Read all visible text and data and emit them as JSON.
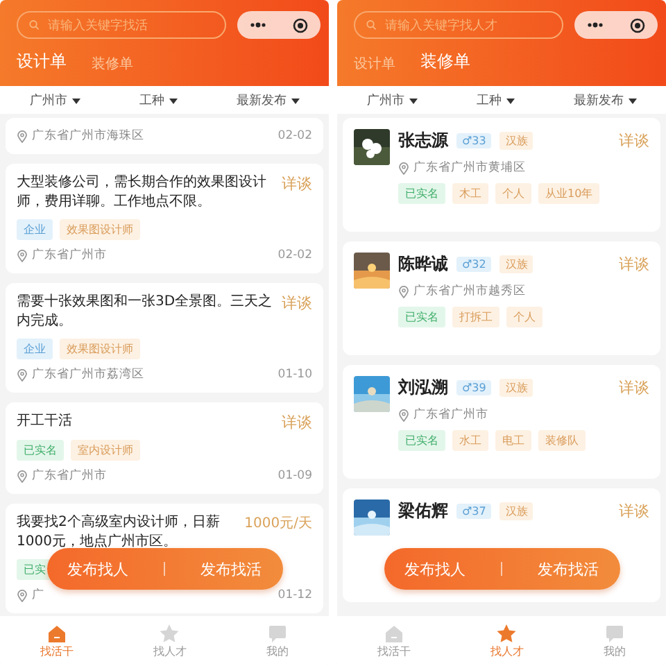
{
  "screens": [
    {
      "search": {
        "placeholder": "请输入关键字找活"
      },
      "tabs": [
        {
          "label": "设计单",
          "selected": true
        },
        {
          "label": "装修单",
          "selected": false
        }
      ],
      "filters": [
        "广州市",
        "工种",
        "最新发布"
      ],
      "jobs": [
        {
          "location": "广东省广州市海珠区",
          "date": "02-02"
        },
        {
          "title": "大型装修公司，需长期合作的效果图设计师，费用详聊。工作地点不限。",
          "pay": "详谈",
          "tags": [
            {
              "kind": "company",
              "label": "企业"
            },
            {
              "kind": "trade",
              "label": "效果图设计师"
            }
          ],
          "location": "广东省广州市",
          "date": "02-02"
        },
        {
          "title": "需要十张效果图和一张3D全景图。三天之内完成。",
          "pay": "详谈",
          "tags": [
            {
              "kind": "company",
              "label": "企业"
            },
            {
              "kind": "trade",
              "label": "效果图设计师"
            }
          ],
          "location": "广东省广州市荔湾区",
          "date": "01-10"
        },
        {
          "title": "开工干活",
          "pay": "详谈",
          "tags": [
            {
              "kind": "verified",
              "label": "已实名"
            },
            {
              "kind": "trade",
              "label": "室内设计师"
            }
          ],
          "location": "广东省广州市",
          "date": "01-09"
        },
        {
          "title": "我要找2个高级室内设计师，日薪1000元，地点广州市区。",
          "pay": "1000元/天",
          "tags": [
            {
              "kind": "verified",
              "label": "已实"
            }
          ],
          "location": "广",
          "date": "01-12"
        }
      ],
      "actions": [
        "发布找人",
        "发布找活"
      ],
      "nav": [
        {
          "label": "找活干",
          "selected": true
        },
        {
          "label": "找人才",
          "selected": false
        },
        {
          "label": "我的",
          "selected": false
        }
      ]
    },
    {
      "search": {
        "placeholder": "请输入关键字找人才"
      },
      "tabs": [
        {
          "label": "设计单",
          "selected": false
        },
        {
          "label": "装修单",
          "selected": true
        }
      ],
      "filters": [
        "广州市",
        "工种",
        "最新发布"
      ],
      "workers": [
        {
          "name": "张志源",
          "age": "♂33",
          "ethnicity": "汉族",
          "pay": "详谈",
          "location": "广东省广州市黄埔区",
          "tags": [
            {
              "kind": "verified",
              "label": "已实名"
            },
            {
              "kind": "trade",
              "label": "木工"
            },
            {
              "kind": "trade",
              "label": "个人"
            },
            {
              "kind": "trade",
              "label": "从业10年"
            }
          ]
        },
        {
          "name": "陈晔诚",
          "age": "♂32",
          "ethnicity": "汉族",
          "pay": "详谈",
          "location": "广东省广州市越秀区",
          "tags": [
            {
              "kind": "verified",
              "label": "已实名"
            },
            {
              "kind": "trade",
              "label": "打拆工"
            },
            {
              "kind": "trade",
              "label": "个人"
            }
          ]
        },
        {
          "name": "刘泓溯",
          "age": "♂39",
          "ethnicity": "汉族",
          "pay": "详谈",
          "location": "广东省广州市",
          "tags": [
            {
              "kind": "verified",
              "label": "已实名"
            },
            {
              "kind": "trade",
              "label": "水工"
            },
            {
              "kind": "trade",
              "label": "电工"
            },
            {
              "kind": "trade",
              "label": "装修队"
            }
          ]
        },
        {
          "name": "梁佑辉",
          "age": "♂37",
          "ethnicity": "汉族",
          "pay": "详谈"
        }
      ],
      "actions": [
        "发布找人",
        "发布找活"
      ],
      "nav": [
        {
          "label": "找活干",
          "selected": false
        },
        {
          "label": "找人才",
          "selected": true
        },
        {
          "label": "我的",
          "selected": false
        }
      ]
    }
  ]
}
